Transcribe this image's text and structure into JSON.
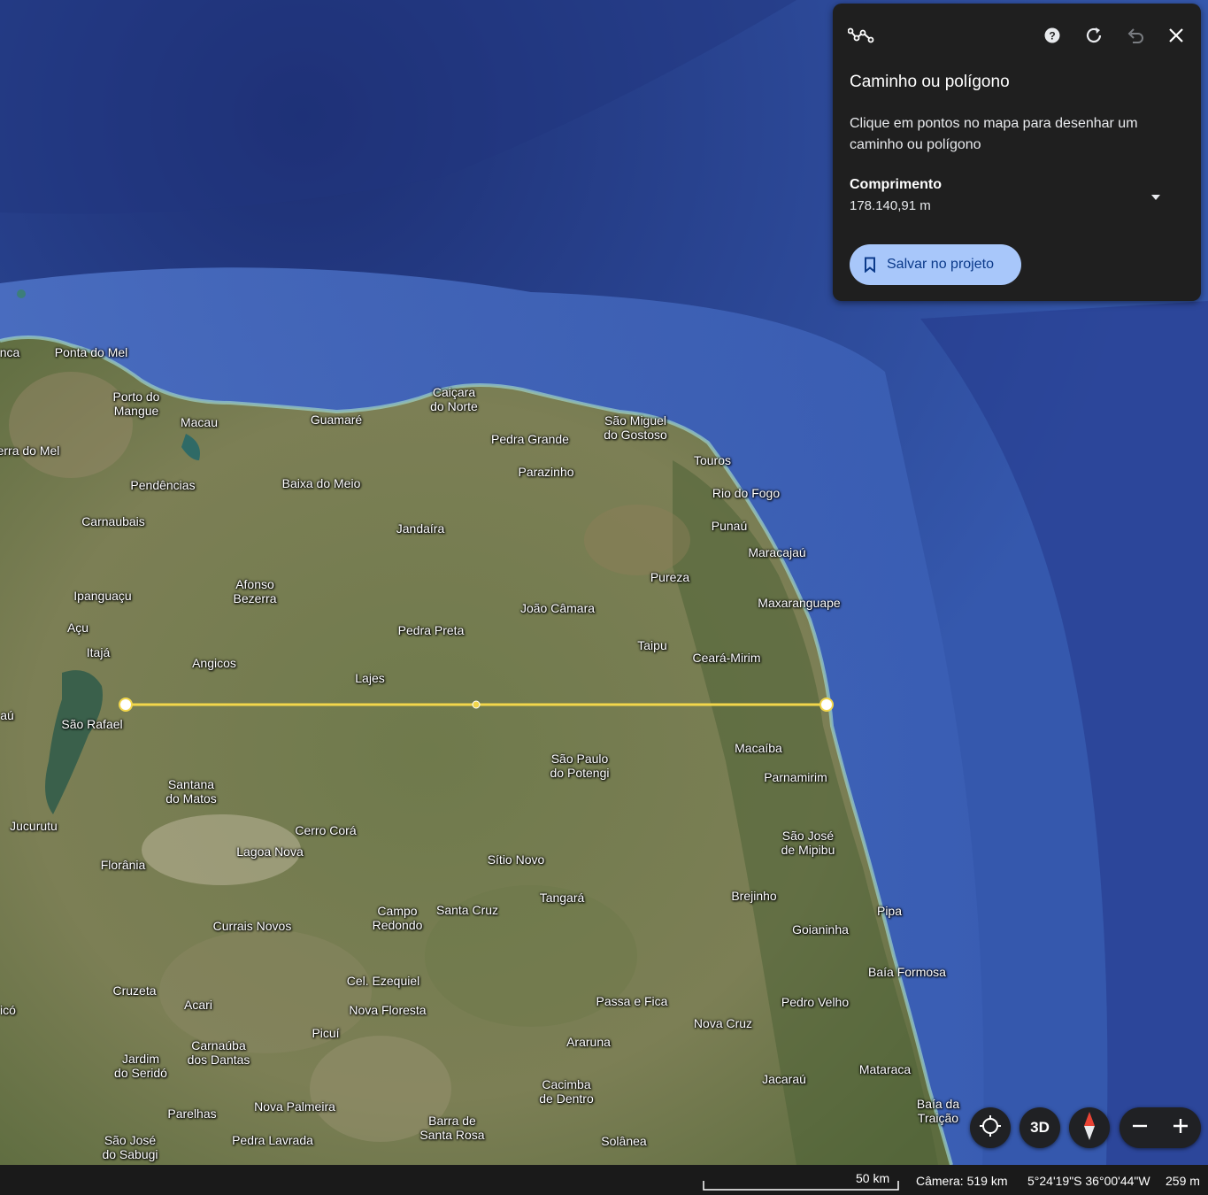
{
  "panel": {
    "title": "Caminho ou polígono",
    "description": "Clique em pontos no mapa para desenhar um caminho ou polígono",
    "length_label": "Comprimento",
    "length_value": "178.140,91 m",
    "save_label": "Salvar no projeto",
    "icons": [
      "path-measure-icon",
      "help-icon",
      "refresh-icon",
      "undo-icon",
      "close-icon",
      "chevron-down-icon",
      "bookmark-icon"
    ]
  },
  "places": [
    "Ponta do Mel",
    "Porto do\nMangue",
    "Macau",
    "Guamaré",
    "Caiçara\ndo Norte",
    "São Miguel\ndo Gostoso",
    "Pedra Grande",
    "Touros",
    "Parazinho",
    "Rio do Fogo",
    "erra do Mel",
    "Pendências",
    "Baixa do Meio",
    "Carnaubais",
    "Jandaíra",
    "Punaú",
    "Maracajaú",
    "Pureza",
    "Ipanguaçu",
    "Afonso\nBezerra",
    "João Câmara",
    "Maxaranguape",
    "Açu",
    "Pedra Preta",
    "Itajá",
    "Taipu",
    "Angicos",
    "Ceará-Mirim",
    "Lajes",
    "São Rafael",
    "Macaíba",
    "São Paulo\ndo Potengi",
    "Parnamirim",
    "Santana\ndo Matos",
    "Jucurutu",
    "Cerro Corá",
    "São José\nde Mipibu",
    "Lagoa Nova",
    "Florânia",
    "Sítio Novo",
    "Tangará",
    "Brejinho",
    "Campo\nRedondo",
    "Santa Cruz",
    "Pipa",
    "Currais Novos",
    "Goianinha",
    "Baía Formosa",
    "Cel. Ezequiel",
    "Cruzeta",
    "Passa e Fica",
    "Acari",
    "Nova Floresta",
    "Pedro Velho",
    "Nova Cruz",
    "Picuí",
    "Carnaúba\ndos Dantas",
    "Araruna",
    "Jardim\ndo Seridó",
    "Cacimba\nde Dentro",
    "Jacaraú",
    "Mataraca",
    "Parelhas",
    "Nova Palmeira",
    "Baía da\nTraição",
    "Barra de\nSanta Rosa",
    "São José\ndo Sabugi",
    "Pedra Lavrada",
    "Solânea",
    "nca",
    "aú",
    "icó"
  ],
  "controls": {
    "mode_3d_label": "3D",
    "icons": [
      "my-location-icon",
      "compass-icon",
      "zoom-out-icon",
      "zoom-in-icon"
    ]
  },
  "status": {
    "scale_label": "50 km",
    "camera": "Câmera: 519 km",
    "coordinates": "5°24'19\"S 36°00'44\"W",
    "elevation": "259 m"
  },
  "colors": {
    "ocean": "#2f4f9a",
    "land": "#6b7a4a",
    "measure_line": "#f2d64b",
    "panel_bg": "#1f1f1f",
    "save_button": "#a8c7fa"
  }
}
